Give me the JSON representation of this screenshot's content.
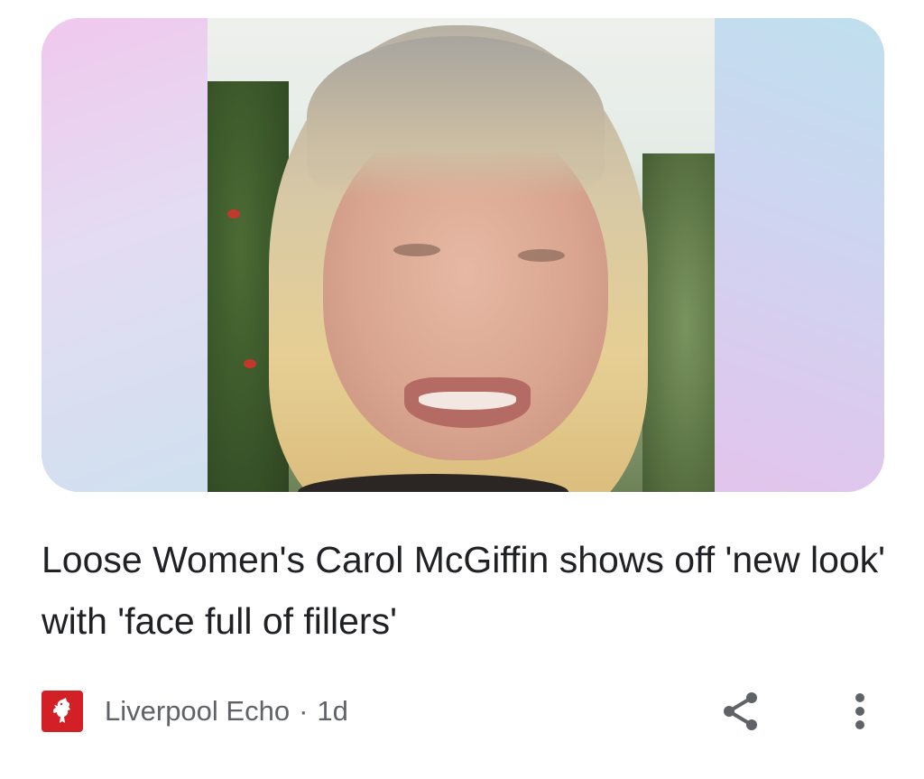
{
  "article": {
    "headline": "Loose Women's Carol McGiffin shows off 'new look' with 'face full of fillers'",
    "image": {
      "description_icon": "photo-thumbnail"
    }
  },
  "source": {
    "name": "Liverpool Echo",
    "separator": "·",
    "age": "1d",
    "logo_icon": "liverbird-icon",
    "logo_color": "#d32027"
  },
  "actions": {
    "share_icon": "share-icon",
    "more_icon": "more-vert-icon"
  },
  "colors": {
    "headline_text": "#202124",
    "meta_text": "#5f6368",
    "icon": "#5f6368"
  }
}
